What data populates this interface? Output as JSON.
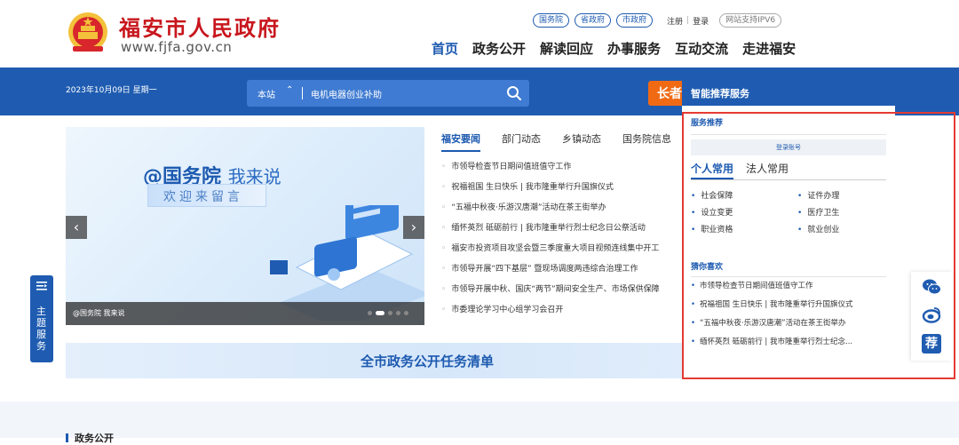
{
  "header": {
    "site_title": "福安市人民政府",
    "site_url": "www.fjfa.gov.cn",
    "top_links": {
      "pills": [
        "国务院",
        "省政府",
        "市政府"
      ],
      "register": "注册",
      "separator": "|",
      "login": "登录",
      "ipv6": "网站支持IPV6"
    },
    "nav": [
      "首页",
      "政务公开",
      "解读回应",
      "办事服务",
      "互动交流",
      "走进福安"
    ]
  },
  "bluebar": {
    "date": "2023年10月09日 星期一",
    "search_scope": "本站",
    "search_caret": "⌃",
    "search_value": "电机电器创业补助",
    "orange_label": "长者"
  },
  "carousel": {
    "title_bold": "@国务院",
    "title_light": "我来说",
    "subtitle": "欢迎来留言",
    "caption": "@国务院 我来说",
    "prev": "‹",
    "next": "›"
  },
  "news": {
    "tabs": [
      "福安要闻",
      "部门动态",
      "乡镇动态",
      "国务院信息"
    ],
    "bullet": "◦",
    "items": [
      "市领导检查节日期间值班值守工作",
      "祝福祖国 生日快乐 | 我市隆重举行升国旗仪式",
      "“五福中秋夜·乐游汉唐潮”活动在茶王街举办",
      "缅怀英烈 砥砺前行 | 我市隆重举行烈士纪念日公祭活动",
      "福安市投资项目攻坚会暨三季度重大项目视频连线集中开工",
      "市领导开展“四下基层” 暨现场调度两违综合治理工作",
      "市领导开展中秋、国庆“两节”期间安全生产、市场保供保障",
      "市委理论学习中心组学习会召开"
    ]
  },
  "task_banner": "全市政务公开任务清单",
  "bottom": {
    "section_title": "政务公开"
  },
  "theme_tab": {
    "label": "主题服务"
  },
  "recommend": {
    "header": "智能推荐服务",
    "service_title": "服务推荐",
    "login_hint": "登录账号",
    "tabs": [
      "个人常用",
      "法人常用"
    ],
    "bullet": "•",
    "services": [
      "社会保障",
      "证件办理",
      "设立变更",
      "医疗卫生",
      "职业资格",
      "就业创业"
    ],
    "guess_title": "猜你喜欢",
    "guess": [
      "市领导检查节日期间值班值守工作",
      "祝福祖国 生日快乐 | 我市隆重举行升国旗仪式",
      "“五福中秋夜·乐游汉唐潮”活动在茶王街举办",
      "缅怀英烈 砥砺前行 | 我市隆重举行烈士纪念..."
    ]
  },
  "float_tools": {
    "recommend_glyph": "荐"
  },
  "colors": {
    "primary": "#1f5cb1",
    "accent": "#c8161d",
    "orange": "#f06a14",
    "highlight_border": "#e43b32"
  },
  "icons": [
    "emblem-icon",
    "search-icon",
    "chevron-left-icon",
    "chevron-right-icon",
    "menu-icon",
    "wechat-icon",
    "weibo-icon",
    "recommend-icon"
  ]
}
